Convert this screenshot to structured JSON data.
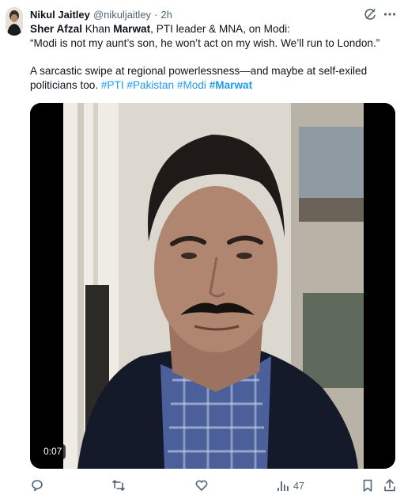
{
  "tweet": {
    "author": {
      "display_name": "Nikul Jaitley",
      "handle": "@nikuljaitley",
      "separator": "·",
      "time": "2h"
    },
    "text": {
      "line1": {
        "first": "Sher Afzal",
        "mid1": " Khan ",
        "bold2": "Marwat",
        "rest": ", PTI leader & MNA, on Modi:"
      },
      "line2": "“Modi is not my aunt’s son, he won’t act on my wish. We’ll run to London.”",
      "para2": "A sarcastic swipe at regional powerlessness—and maybe at self-exiled politicians too. ",
      "hashtags": [
        "#PTI",
        "#Pakistan",
        "#Modi",
        "#Marwat"
      ]
    },
    "video": {
      "timestamp": "0:07"
    },
    "actions": {
      "reply": "",
      "repost": "",
      "like": "",
      "views": "47"
    },
    "icons": {
      "grok": "grok-icon",
      "more": "more-icon",
      "reply": "reply-icon",
      "repost": "repost-icon",
      "like": "like-icon",
      "views": "views-icon",
      "bookmark": "bookmark-icon",
      "share": "share-icon"
    },
    "colors": {
      "link": "#1d9bf0",
      "muted": "#536471",
      "text": "#0f1419"
    }
  }
}
